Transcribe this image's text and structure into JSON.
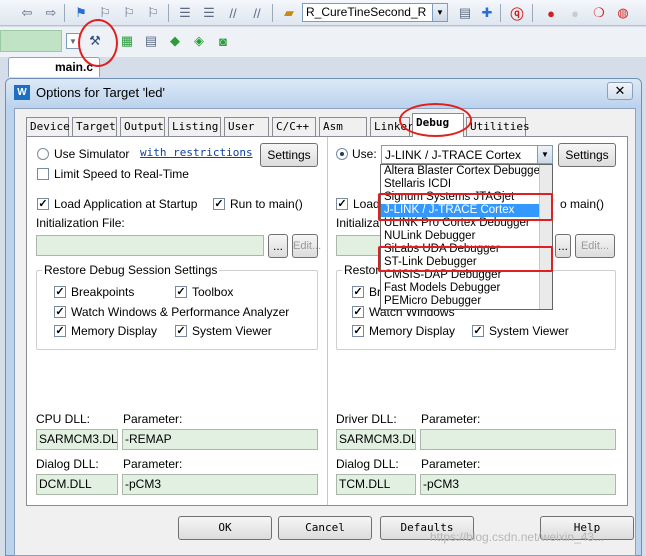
{
  "toolbar": {
    "target_name": "R_CureTineSecond_R",
    "icons": [
      "back-arrow-icon",
      "forward-arrow-icon",
      "bookmark-icon",
      "bookmark-prev-icon",
      "bookmark-next-icon",
      "bookmark-clear-icon",
      "indent-icon",
      "unindent-icon",
      "comment-icon",
      "uncomment-icon",
      "open-folder-icon",
      "debug-icon",
      "breakpoint-icon",
      "breakpoint-disabled-icon",
      "kill-breakpoints-icon",
      "options-magic-wand-icon",
      "packs-icon",
      "manage-components-icon",
      "diamond-icon",
      "boat-icon",
      "layers-icon"
    ]
  },
  "file_tab": "main.c",
  "dialog": {
    "title": "Options for Target 'led'",
    "close": "✕",
    "tabs": [
      "Device",
      "Target",
      "Output",
      "Listing",
      "User",
      "C/C++",
      "Asm",
      "Linker",
      "Debug",
      "Utilities"
    ],
    "active_tab": "Debug"
  },
  "left": {
    "use_simulator": "Use Simulator",
    "with_restrictions": "with restrictions",
    "settings": "Settings",
    "limit_speed": "Limit Speed to Real-Time",
    "load_app": "Load Application at Startup",
    "run_to_main": "Run to main()",
    "init_file_label": "Initialization File:",
    "browse": "...",
    "edit": "Edit...",
    "restore_title": "Restore Debug Session Settings",
    "breakpoints": "Breakpoints",
    "toolbox": "Toolbox",
    "watch_windows": "Watch Windows & Performance Analyzer",
    "memory_display": "Memory Display",
    "system_viewer": "System Viewer",
    "cpu_dll_label": "CPU DLL:",
    "cpu_param_label": "Parameter:",
    "cpu_dll": "SARMCM3.DLL",
    "cpu_param": "-REMAP",
    "dialog_dll_label": "Dialog DLL:",
    "dialog_param_label": "Parameter:",
    "dialog_dll": "DCM.DLL",
    "dialog_param": "-pCM3"
  },
  "right": {
    "use": "Use:",
    "selected_debugger": "J-LINK / J-TRACE Cortex",
    "settings": "Settings",
    "load_partial": "Load",
    "run_partial": "o main()",
    "init_partial": "Initializa",
    "browse": "...",
    "edit": "Edit...",
    "restore_partial": "Restore",
    "breakpoints_partial": "Brea",
    "watch_windows": "Watch Windows",
    "memory_display": "Memory Display",
    "system_viewer": "System Viewer",
    "driver_dll_label": "Driver DLL:",
    "driver_param_label": "Parameter:",
    "driver_dll": "SARMCM3.DLL",
    "driver_param": "",
    "dialog_dll_label": "Dialog DLL:",
    "dialog_param_label": "Parameter:",
    "dialog_dll": "TCM.DLL",
    "dialog_param": "-pCM3",
    "debugger_options": [
      "Altera Blaster Cortex Debugger",
      "Stellaris ICDI",
      "Signum Systems JTAGjet",
      "J-LINK / J-TRACE Cortex",
      "ULINK Pro Cortex Debugger",
      "NULink Debugger",
      "SiLabs UDA Debugger",
      "ST-Link Debugger",
      "CMSIS-DAP Debugger",
      "Fast Models Debugger",
      "PEMicro Debugger"
    ],
    "highlighted_index": 3
  },
  "footer": {
    "ok": "OK",
    "cancel": "Cancel",
    "defaults": "Defaults",
    "help": "Help"
  },
  "watermark": "https://blog.csdn.net/weixin_43..."
}
